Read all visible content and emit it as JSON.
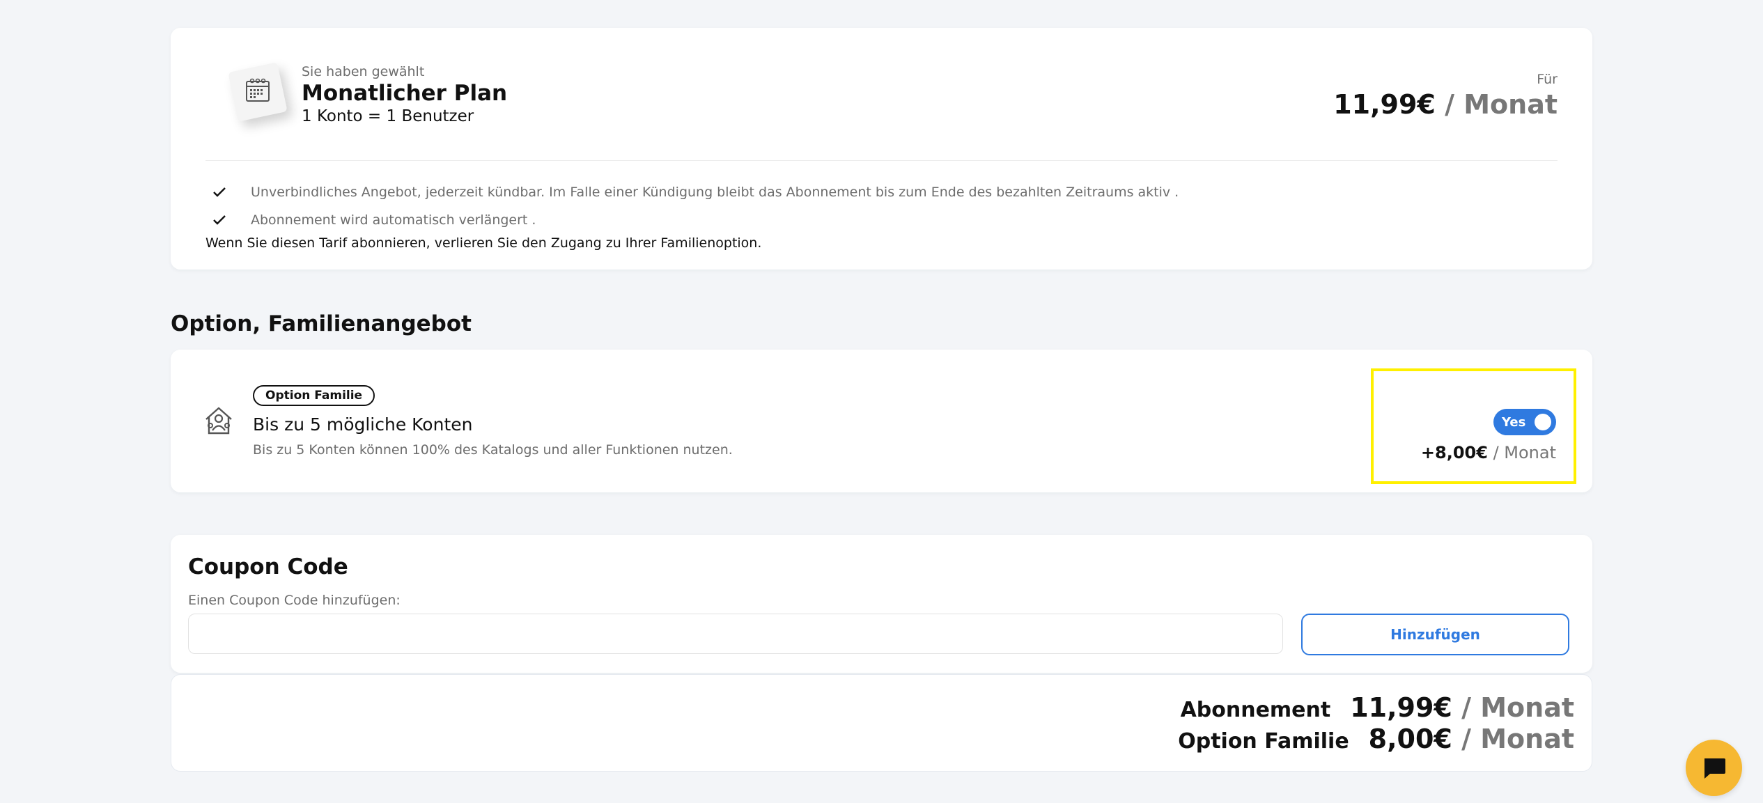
{
  "plan": {
    "eyebrow": "Sie haben gewählt",
    "name": "Monatlicher Plan",
    "users": "1 Konto = 1 Benutzer",
    "for_label": "Für",
    "price": "11,99€",
    "price_unit": "/ Monat",
    "features": [
      "Unverbindliches Angebot, jederzeit kündbar. Im Falle einer Kündigung bleibt das Abonnement bis zum Ende des bezahlten Zeitraums aktiv .",
      "Abonnement wird automatisch verlängert ."
    ],
    "warning": "Wenn Sie diesen Tarif abonnieren, verlieren Sie den Zugang zu Ihrer Familienoption."
  },
  "family_section": {
    "title": "Option, Familienangebot",
    "badge": "Option Familie",
    "headline": "Bis zu 5 mögliche Konten",
    "description": "Bis zu 5 Konten können 100% des Katalogs und aller Funktionen nutzen.",
    "toggle_label": "Yes",
    "toggle_on": true,
    "price": "+8,00€",
    "price_unit": "/ Monat"
  },
  "coupon": {
    "title": "Coupon Code",
    "label": "Einen Coupon Code hinzufügen:",
    "input_value": "",
    "button_label": "Hinzufügen"
  },
  "summary": {
    "rows": [
      {
        "label": "Abonnement",
        "price": "11,99€",
        "unit": "/ Monat"
      },
      {
        "label": "Option Familie",
        "price": "8,00€",
        "unit": "/ Monat"
      }
    ]
  },
  "icons": {
    "plan": "calendar-icon",
    "check": "check-icon",
    "family": "family-house-icon",
    "chat": "chat-bubble-icon"
  },
  "colors": {
    "background": "#f3f5f8",
    "accent": "#2f7ae0",
    "highlight": "#fff000",
    "chat": "#f6b832"
  }
}
